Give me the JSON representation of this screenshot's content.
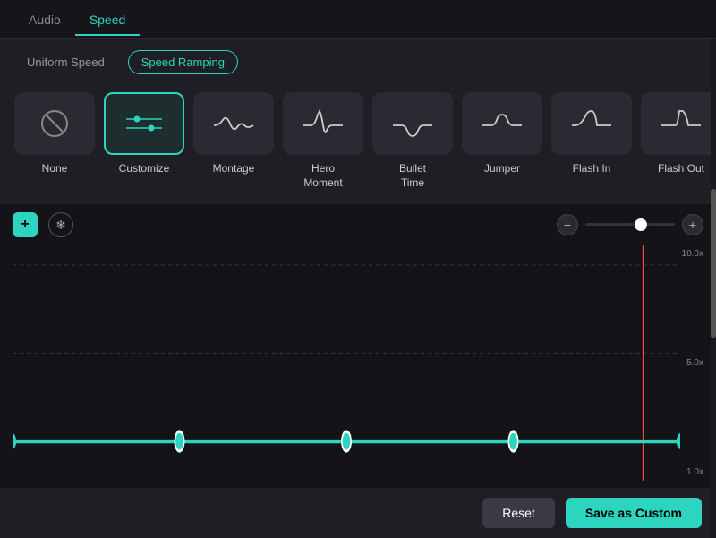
{
  "tabs": [
    {
      "label": "Audio",
      "active": false
    },
    {
      "label": "Speed",
      "active": true
    }
  ],
  "modes": [
    {
      "label": "Uniform Speed",
      "active": false
    },
    {
      "label": "Speed Ramping",
      "active": true
    }
  ],
  "presets": [
    {
      "id": "none",
      "label": "None",
      "icon": "none",
      "selected": false
    },
    {
      "id": "customize",
      "label": "Customize",
      "icon": "customize",
      "selected": true
    },
    {
      "id": "montage",
      "label": "Montage",
      "icon": "montage",
      "selected": false
    },
    {
      "id": "hero-moment",
      "label": "Hero\nMoment",
      "icon": "hero-moment",
      "selected": false
    },
    {
      "id": "bullet-time",
      "label": "Bullet\nTime",
      "icon": "bullet-time",
      "selected": false
    },
    {
      "id": "jumper",
      "label": "Jumper",
      "icon": "jumper",
      "selected": false
    },
    {
      "id": "flash-in",
      "label": "Flash In",
      "icon": "flash-in",
      "selected": false
    },
    {
      "id": "flash-out",
      "label": "Flash Out",
      "icon": "flash-out",
      "selected": false
    }
  ],
  "toolbar": {
    "add_label": "+",
    "snowflake_label": "❄",
    "zoom_minus": "−",
    "zoom_plus": "+"
  },
  "graph": {
    "labels": [
      "10.0x",
      "5.0x",
      "1.0x"
    ]
  },
  "buttons": {
    "reset": "Reset",
    "save_custom": "Save as Custom"
  }
}
